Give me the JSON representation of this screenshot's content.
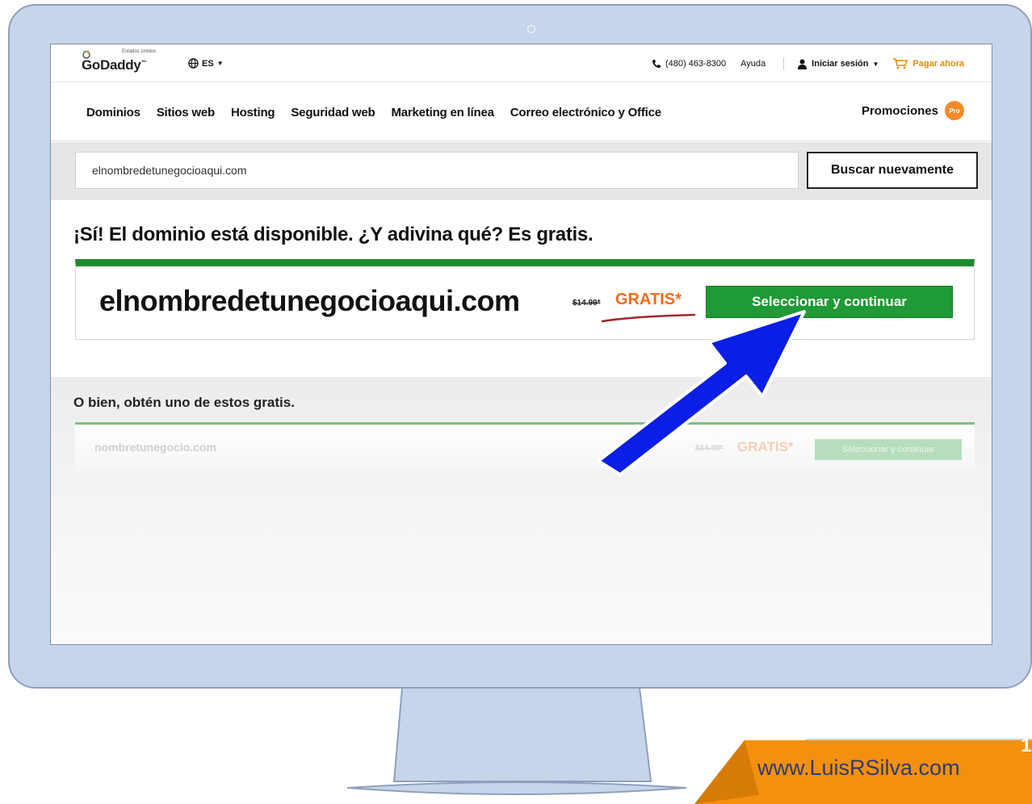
{
  "header": {
    "logo_region": "Estados Unidos",
    "logo_name": "GoDaddy",
    "logo_tm": "™",
    "language": "ES",
    "phone": "(480) 463-8300",
    "help": "Ayuda",
    "login": "Iniciar sesión",
    "cart": "Pagar ahora"
  },
  "nav": {
    "items": [
      "Dominios",
      "Sitios web",
      "Hosting",
      "Seguridad web",
      "Marketing en línea",
      "Correo electrónico y Office"
    ],
    "promotions": "Promociones",
    "pro_badge": "Pro"
  },
  "search": {
    "value": "elnombredetunegocioaqui.com",
    "button": "Buscar nuevamente"
  },
  "result": {
    "headline": "¡Sí! El dominio está disponible. ¿Y adivina qué? Es gratis.",
    "domain": "elnombredetunegocioaqui.com",
    "old_price": "$14.99*",
    "free_label": "GRATIS*",
    "select_button": "Seleccionar y continuar"
  },
  "alternatives": {
    "title": "O bien, obtén uno de estos gratis.",
    "items": [
      {
        "domain": "nombretunegocio.com",
        "old_price": "$14.99*",
        "free_label": "GRATIS*",
        "button": "Seleccionar y continuar"
      }
    ]
  },
  "branding": {
    "url": "www.LuisRSilva.com",
    "page_number": "1"
  },
  "colors": {
    "monitor": "#c6d5ea",
    "accent_green": "#1f9a36",
    "accent_orange": "#f26b1d",
    "arrow_blue": "#0a1ee6",
    "brand_orange": "#f5900f"
  }
}
